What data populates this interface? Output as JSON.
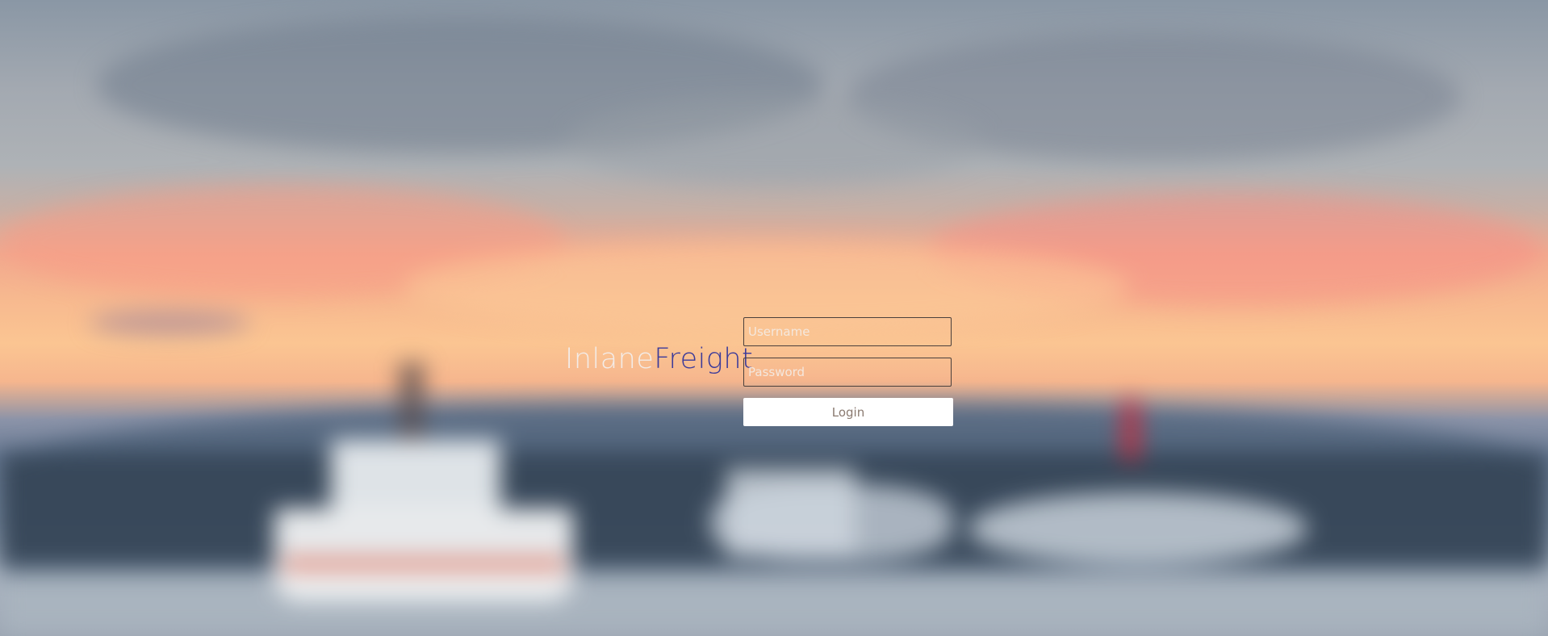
{
  "brand": {
    "name_part1": "Inlane",
    "name_part2": "Freight",
    "color_part1": "#f3ece8",
    "color_part2": "#3b3a9a"
  },
  "login_form": {
    "username_placeholder": "Username",
    "username_value": "",
    "password_placeholder": "Password",
    "password_value": "",
    "login_label": "Login"
  },
  "background": {
    "description_icon": "blurred-harbor-sunset-photo"
  }
}
